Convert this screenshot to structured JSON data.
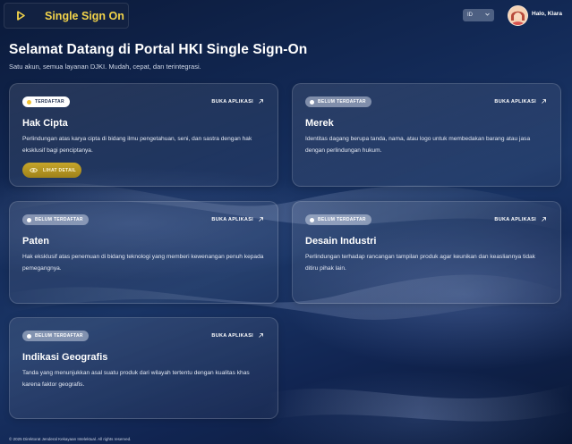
{
  "header": {
    "brand_title": "Single Sign On",
    "language": "ID",
    "greeting": "Halo, Klara"
  },
  "hero": {
    "title": "Selamat Datang di Portal HKI Single Sign-On",
    "subtitle": "Satu akun, semua layanan DJKI. Mudah, cepat, dan terintegrasi."
  },
  "cards": [
    {
      "status": "TERDAFTAR",
      "open_label": "BUKA APLIKASI",
      "title": "Hak Cipta",
      "description": "Perlindungan atas karya cipta di bidang ilmu pengetahuan, seni, dan sastra dengan hak eksklusif bagi penciptanya.",
      "detail_label": "LIHAT DETAIL"
    },
    {
      "status": "BELUM TERDAFTAR",
      "open_label": "BUKA APLIKASI",
      "title": "Merek",
      "description": "Identitas dagang berupa tanda, nama, atau logo untuk membedakan barang atau jasa dengan perlindungan hukum."
    },
    {
      "status": "BELUM TERDAFTAR",
      "open_label": "BUKA APLIKASI",
      "title": "Paten",
      "description": "Hak eksklusif atas penemuan di bidang teknologi yang memberi kewenangan penuh kepada pemegangnya."
    },
    {
      "status": "BELUM TERDAFTAR",
      "open_label": "BUKA APLIKASI",
      "title": "Desain Industri",
      "description": "Perlindungan terhadap rancangan tampilan produk agar keunikan dan keasliannya tidak ditiru pihak lain."
    },
    {
      "status": "BELUM TERDAFTAR",
      "open_label": "BUKA APLIKASI",
      "title": "Indikasi Geografis",
      "description": "Tanda yang menunjukkan asal suatu produk dari wilayah tertentu dengan kualitas khas karena faktor geografis."
    }
  ],
  "footer": {
    "copyright": "© 2025 Direktorat Jenderal Kekayaan Intelektual. All rights reserved."
  },
  "colors": {
    "brand_yellow": "#f2d34a",
    "registered_dot": "#f1c232",
    "detail_button": "#b39422",
    "background_navy": "#132a57"
  }
}
